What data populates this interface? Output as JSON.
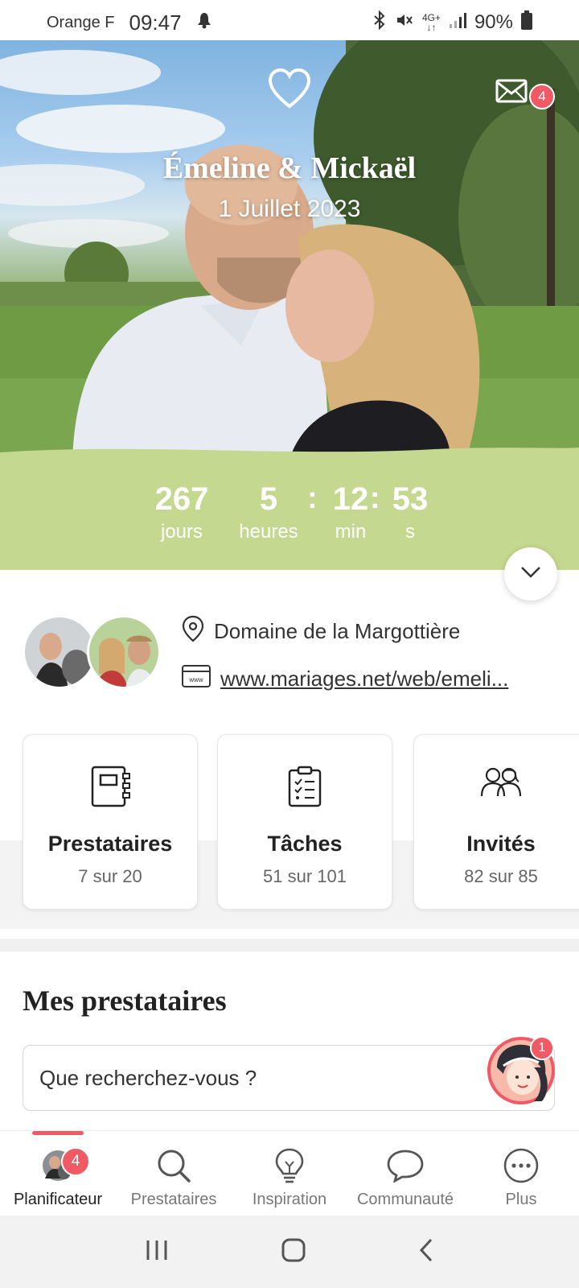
{
  "status_bar": {
    "carrier": "Orange F",
    "time": "09:47",
    "network": "4G+",
    "battery": "90%"
  },
  "hero": {
    "couple_name": "Émeline & Mickaël",
    "wedding_date": "1 Juillet 2023",
    "messages_badge": "4"
  },
  "countdown": {
    "days": "267",
    "days_label": "jours",
    "hours": "5",
    "hours_label": "heures",
    "minutes": "12",
    "minutes_label": "min",
    "seconds": "53",
    "seconds_label": "s",
    "separator": ":"
  },
  "info": {
    "venue": "Domaine de la Margottière",
    "website": "www.mariages.net/web/emeli..."
  },
  "cards": [
    {
      "title": "Prestataires",
      "subtitle": "7 sur 20",
      "icon": "notebook-icon"
    },
    {
      "title": "Tâches",
      "subtitle": "51 sur 101",
      "icon": "clipboard-list-icon"
    },
    {
      "title": "Invités",
      "subtitle": "82 sur 85",
      "icon": "guests-icon"
    }
  ],
  "vendors": {
    "title": "Mes prestataires",
    "search_placeholder": "Que recherchez-vous ?",
    "assistant_badge": "1"
  },
  "bottom_nav": {
    "items": [
      {
        "label": "Planificateur",
        "badge": "4",
        "icon": "avatar-icon"
      },
      {
        "label": "Prestataires",
        "icon": "search-icon"
      },
      {
        "label": "Inspiration",
        "icon": "lightbulb-icon"
      },
      {
        "label": "Communauté",
        "icon": "chat-bubble-icon"
      },
      {
        "label": "Plus",
        "icon": "more-icon"
      }
    ]
  },
  "colors": {
    "accent": "#f05a64",
    "countdown_bg": "#c5d88f"
  }
}
